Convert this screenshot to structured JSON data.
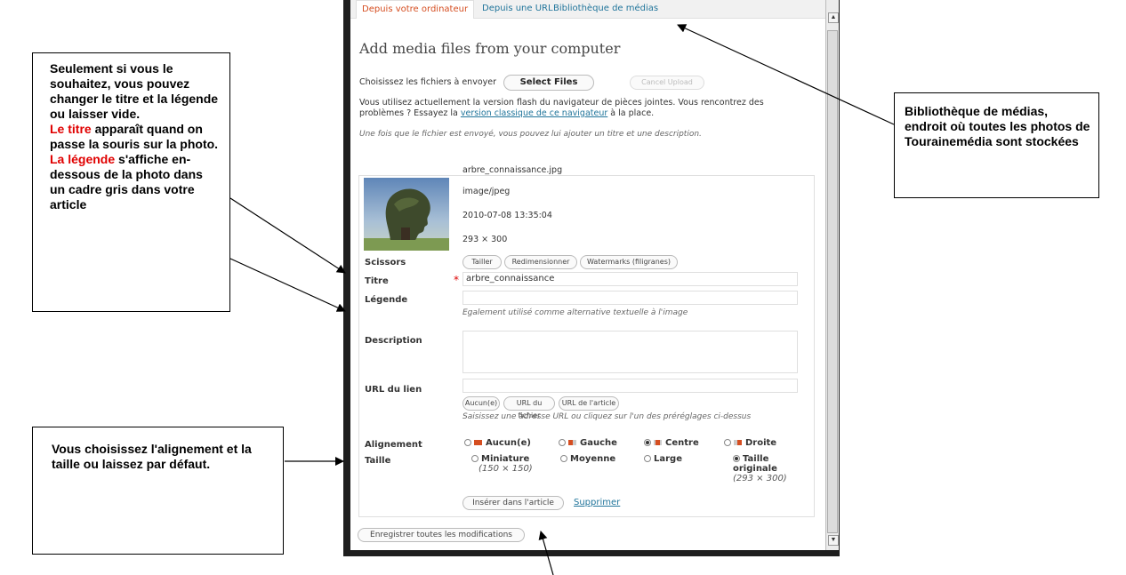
{
  "tabs": [
    {
      "label": "Depuis votre ordinateur"
    },
    {
      "label": "Depuis une URL"
    },
    {
      "label": "Bibliothèque de médias"
    }
  ],
  "heading": "Add media files from your computer",
  "upload": {
    "choose_text": "Choisissez les fichiers à envoyer",
    "select_label": "Select Files",
    "cancel_label": "Cancel Upload",
    "flash_line1": "Vous utilisez actuellement la version flash du navigateur de pièces jointes. Vous rencontrez des",
    "flash_line2_pre": "problèmes ? Essayez la ",
    "flash_link": "version classique de ce navigateur",
    "flash_line2_post": " à la place.",
    "hint": "Une fois que le fichier est envoyé, vous pouvez lui ajouter un titre et une description."
  },
  "file": {
    "name": "arbre_connaissance.jpg",
    "type": "image/jpeg",
    "date": "2010-07-08 13:35:04",
    "dims": "293 × 300"
  },
  "scissors": {
    "label": "Scissors",
    "buttons": [
      "Tailler",
      "Redimensionner",
      "Watermarks (filigranes)"
    ]
  },
  "titre": {
    "label": "Titre",
    "required_mark": "*",
    "value": "arbre_connaissance"
  },
  "legende": {
    "label": "Légende",
    "value": "",
    "help": "Egalement utilisé comme alternative textuelle à l'image"
  },
  "description": {
    "label": "Description",
    "value": ""
  },
  "url": {
    "label": "URL du lien",
    "value": "",
    "buttons": [
      "Aucun(e)",
      "URL du fichier",
      "URL de l'article"
    ],
    "help": "Saisissez une adresse URL ou cliquez sur l'un des préréglages ci-dessus"
  },
  "alignement": {
    "label": "Alignement",
    "options": [
      "Aucun(e)",
      "Gauche",
      "Centre",
      "Droite"
    ],
    "selected": "Centre",
    "accent": "#d54e21"
  },
  "taille": {
    "label": "Taille",
    "options": [
      {
        "label": "Miniature",
        "dim": "(150 × 150)"
      },
      {
        "label": "Moyenne",
        "dim": ""
      },
      {
        "label": "Large",
        "dim": ""
      },
      {
        "label": "Taille originale",
        "dim": "(293 × 300)"
      }
    ],
    "selected": "Taille originale"
  },
  "actions": {
    "insert": "Insérer dans l'article",
    "delete": "Supprimer",
    "save_all": "Enregistrer toutes les modifications"
  },
  "callouts": {
    "left_top": {
      "intro": "Seulement si vous le souhaitez, vous pouvez changer le titre et la légende ou laisser vide.",
      "titre_word": "Le titre",
      "titre_rest": " apparaît quand on passe la souris sur la photo.",
      "legende_word": "La légende",
      "legende_rest": " s'affiche en-dessous de la photo dans un cadre gris dans votre article"
    },
    "left_bottom": "Vous choisissez l'alignement et la taille ou laissez par défaut.",
    "right": "Bibliothèque de médias, endroit où toutes les photos de Tourainemédia sont stockées"
  },
  "colors": {
    "accent": "#d54e21",
    "link": "#21759b",
    "callout_red": "#e00000"
  }
}
